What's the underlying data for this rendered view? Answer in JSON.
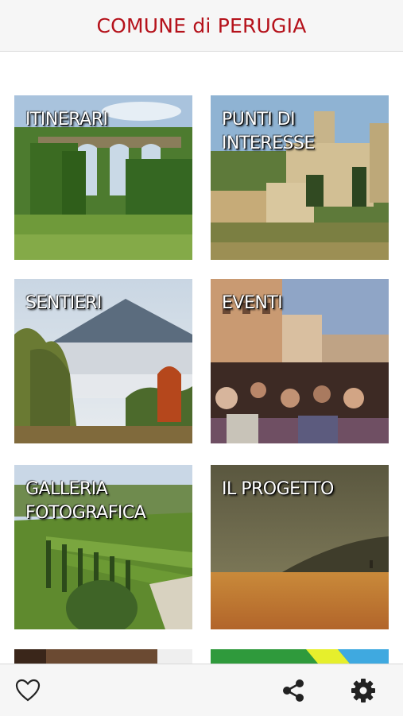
{
  "header": {
    "title": "COMUNE di PERUGIA"
  },
  "tiles": [
    {
      "label": "ITINERARI"
    },
    {
      "label": "PUNTI DI\nINTERESSE"
    },
    {
      "label": "SENTIERI"
    },
    {
      "label": "EVENTI"
    },
    {
      "label": "GALLERIA\nFOTOGRAFICA"
    },
    {
      "label": "IL PROGETTO"
    }
  ],
  "footer": {
    "icons": [
      "heart-icon",
      "share-icon",
      "gear-icon"
    ]
  },
  "colors": {
    "brand": "#b5121b",
    "header_bg": "#f6f6f6"
  }
}
